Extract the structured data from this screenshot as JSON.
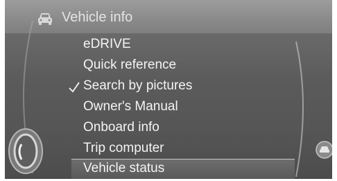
{
  "header": {
    "title": "Vehicle info",
    "icon": "car-icon"
  },
  "menu": {
    "items": [
      {
        "label": "eDRIVE",
        "checked": false,
        "selected": false
      },
      {
        "label": "Quick reference",
        "checked": false,
        "selected": false
      },
      {
        "label": "Search by pictures",
        "checked": true,
        "selected": false
      },
      {
        "label": "Owner's Manual",
        "checked": false,
        "selected": false
      },
      {
        "label": "Onboard info",
        "checked": false,
        "selected": false
      },
      {
        "label": "Trip computer",
        "checked": false,
        "selected": false
      },
      {
        "label": "Vehicle status",
        "checked": false,
        "selected": true
      }
    ]
  },
  "icons": {
    "check": "checkmark-icon",
    "controller": "controller-icon",
    "side_button": "car-icon"
  },
  "colors": {
    "background": "#5b5b5b",
    "title_bar": "#8a8a8a",
    "text": "#f4f4f4"
  }
}
